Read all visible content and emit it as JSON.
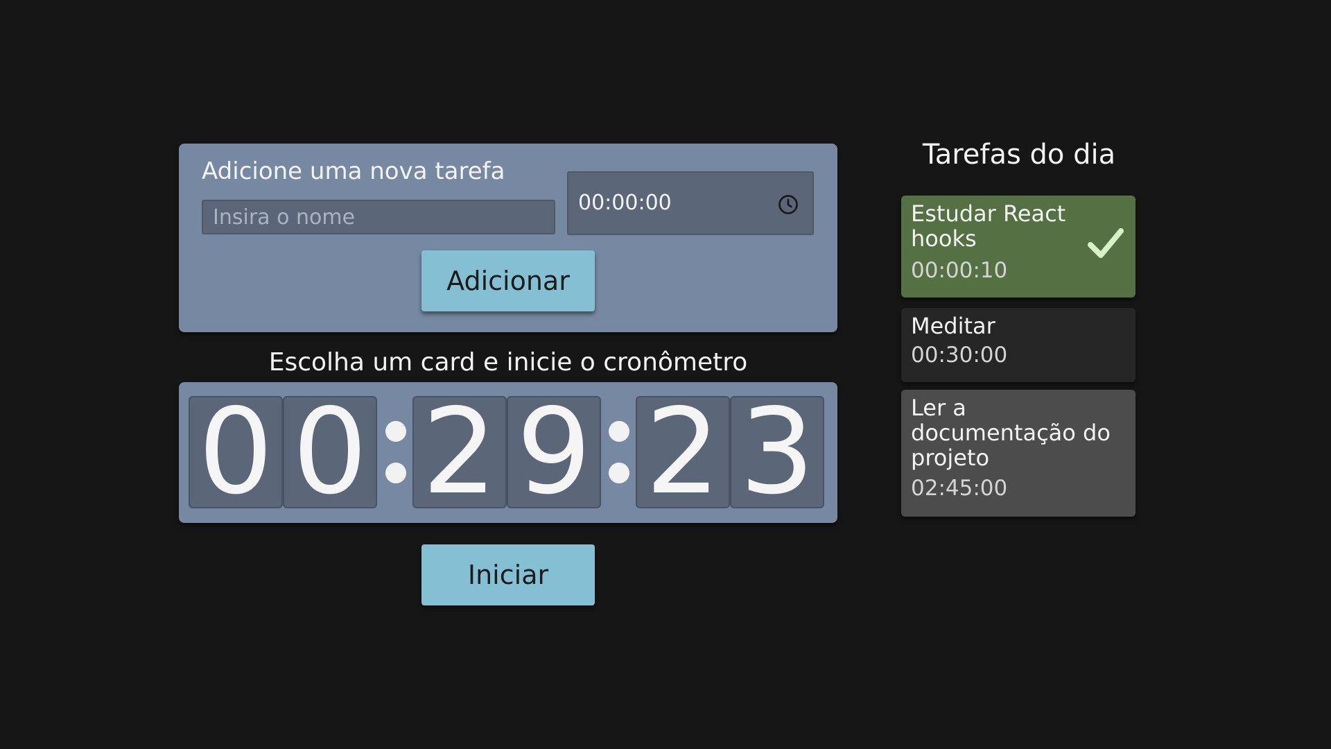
{
  "form": {
    "title": "Adicione uma nova tarefa",
    "name_placeholder": "Insira o nome",
    "name_value": "",
    "time_value": "00:00:00",
    "time_icon": "clock-icon",
    "add_label": "Adicionar"
  },
  "stopwatch": {
    "heading": "Escolha um card e inicie o cronômetro",
    "digits": [
      "0",
      "0",
      "2",
      "9",
      "2",
      "3"
    ],
    "start_label": "Iniciar"
  },
  "tasks": {
    "title": "Tarefas do dia",
    "items": [
      {
        "name": "Estudar React hooks",
        "time": "00:00:10",
        "status": "completed",
        "icon": "check-icon"
      },
      {
        "name": "Meditar",
        "time": "00:30:00",
        "status": "pending"
      },
      {
        "name": "Ler a documentação do projeto",
        "time": "02:45:00",
        "status": "selected"
      }
    ]
  },
  "colors": {
    "background": "#161616",
    "panel": "#7688a2",
    "field": "#5c6679",
    "button": "#85bfd4",
    "task_completed": "#557143",
    "task_pending": "#262626",
    "task_selected": "#4c4c4c",
    "check": "#d8f2c4"
  }
}
